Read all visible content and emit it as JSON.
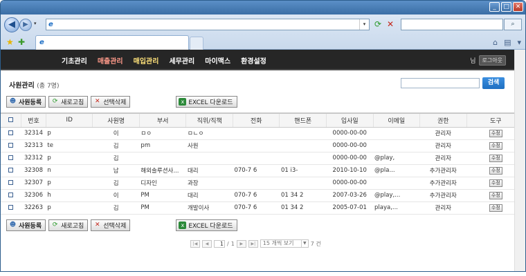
{
  "browser": {
    "back_glyph": "◀",
    "forward_glyph": "▶",
    "refresh_glyph": "⟳",
    "stop_glyph": "✕",
    "search_glyph": "⌕",
    "dropdown_glyph": "▾",
    "ie_glyph": "e",
    "favorites_glyph": "★",
    "add_fav_glyph": "✚",
    "home_glyph": "⌂",
    "feeds_glyph": "▤",
    "page_glyph": "▾",
    "minimize_glyph": "_",
    "maximize_glyph": "□",
    "close_glyph": "✕"
  },
  "nav": {
    "menu": [
      "기초관리",
      "매출관리",
      "매입관리",
      "세무관리",
      "마이맥스",
      "환경설정"
    ],
    "user_suffix": "님",
    "logout": "로그아웃"
  },
  "page": {
    "title": "사원관리",
    "count_text": "(총 7명)",
    "search_button": "검색"
  },
  "toolbar": {
    "register": "사원등록",
    "refresh": "새로고침",
    "delete": "선택삭제",
    "excel": "EXCEL 다운로드",
    "register_icon": "user-icon",
    "refresh_icon": "refresh-icon",
    "delete_icon": "x-icon",
    "excel_icon": "excel-icon"
  },
  "table": {
    "columns": [
      "번호",
      "ID",
      "사원명",
      "부서",
      "직위/직책",
      "전화",
      "핸드폰",
      "입사일",
      "이메일",
      "권한",
      "도구"
    ],
    "rows": [
      {
        "no": "32314",
        "id": "p",
        "name": "이",
        "dept": "ㅁㅇ",
        "position": "ㅁㄴㅇ",
        "phone": "",
        "mobile": "",
        "joined": "0000-00-00",
        "email": "",
        "role": "관리자",
        "tool": "수정"
      },
      {
        "no": "32313",
        "id": "te",
        "name": "김",
        "dept": "pm",
        "position": "사원",
        "phone": "",
        "mobile": "",
        "joined": "0000-00-00",
        "email": "",
        "role": "관리자",
        "tool": "수정"
      },
      {
        "no": "32312",
        "id": "p",
        "name": "김",
        "dept": "",
        "position": "",
        "phone": "",
        "mobile": "",
        "joined": "0000-00-00",
        "email": "@play,",
        "role": "관리자",
        "tool": "수정"
      },
      {
        "no": "32308",
        "id": "n",
        "name": "남",
        "dept": "해외솔루션사...",
        "position": "대리",
        "phone": "070-7     6",
        "mobile": "01     i3-",
        "joined": "2010-10-10",
        "email": "@pla...",
        "role": "추가관리자",
        "tool": "수정"
      },
      {
        "no": "32307",
        "id": "p",
        "name": "김",
        "dept": "디자인",
        "position": "과장",
        "phone": "",
        "mobile": "",
        "joined": "0000-00-00",
        "email": "",
        "role": "추가관리자",
        "tool": "수정"
      },
      {
        "no": "32306",
        "id": "h",
        "name": "이",
        "dept": "PM",
        "position": "대리",
        "phone": "070-7     6",
        "mobile": "01     34   2",
        "joined": "2007-03-26",
        "email": "@play,...",
        "role": "추가관리자",
        "tool": "수정"
      },
      {
        "no": "32263",
        "id": "p",
        "name": "김",
        "dept": "PM",
        "position": "개발이사",
        "phone": "070-7     6",
        "mobile": "01     34   2",
        "joined": "2005-07-01",
        "email": "playa,...",
        "role": "관리자",
        "tool": "수정"
      }
    ]
  },
  "pager": {
    "first": "|◀",
    "prev": "◀",
    "next": "▶",
    "last": "▶|",
    "current": "1",
    "separator": "/",
    "total_pages": "1",
    "per_page": "15 개씩 보기",
    "total_count": "7 건"
  }
}
